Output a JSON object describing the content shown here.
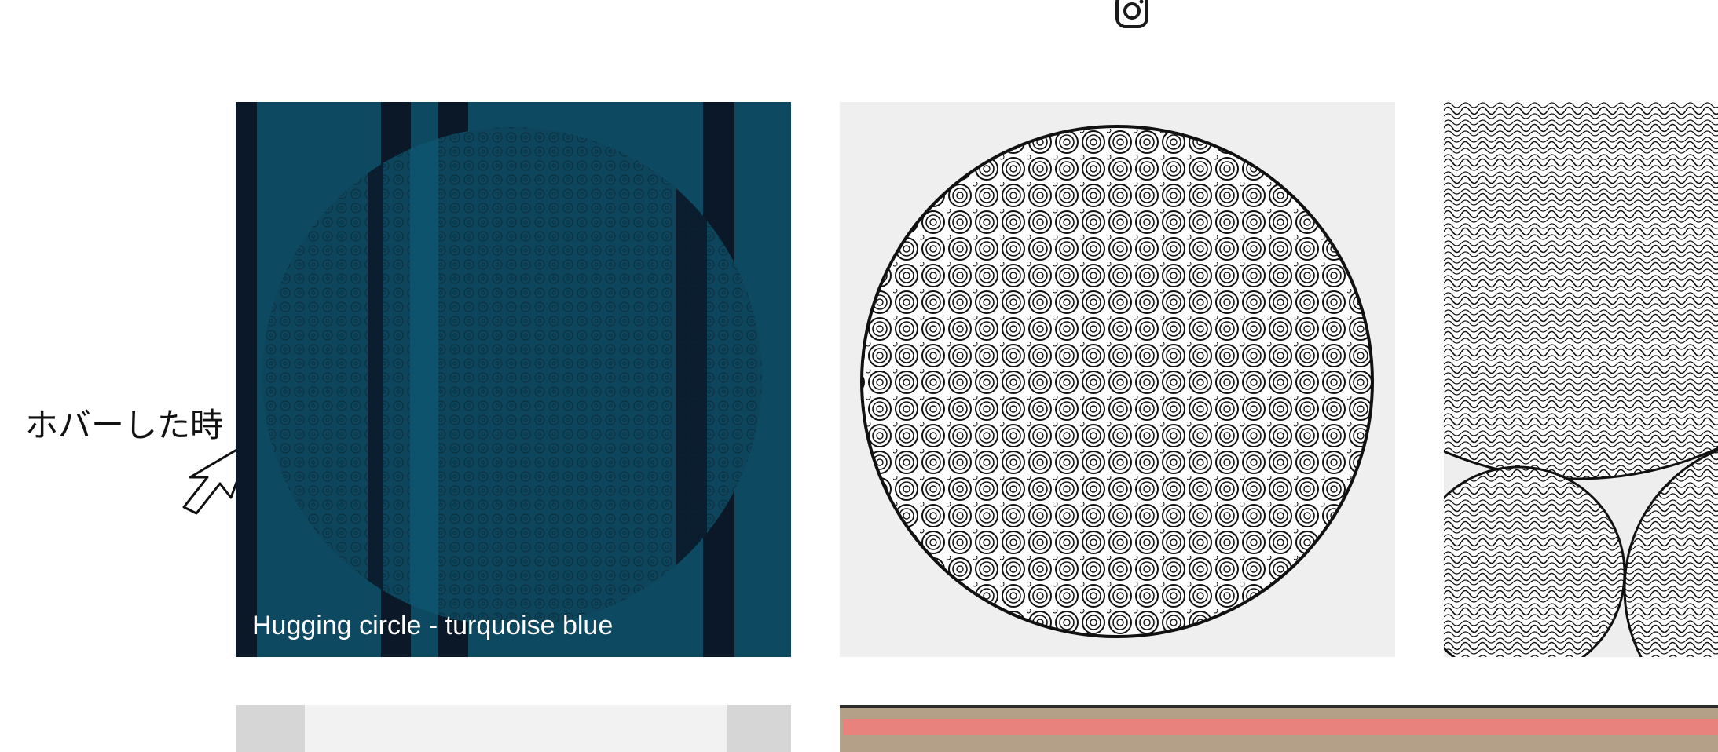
{
  "header": {
    "icon": "instagram-icon"
  },
  "annotation": {
    "label": "ホバーした時",
    "cursor_icon": "arrow-cursor-icon"
  },
  "gallery": {
    "items": [
      {
        "title": "Hugging circle - turquoise blue",
        "colors": {
          "bg": "#0e4a62",
          "stripe": "#0b1522"
        }
      },
      {
        "title": "",
        "colors": {
          "bg": "#efefef",
          "ink": "#111111"
        }
      },
      {
        "title": "",
        "colors": {
          "bg": "#eeeeee",
          "ink": "#111111"
        }
      },
      {
        "title": "",
        "colors": {
          "bg": "#d7d7d7"
        }
      },
      {
        "title": "",
        "colors": {
          "bg": "#b4a089",
          "stripe": "#e8827c"
        }
      }
    ],
    "hover_caption": "Hugging circle - turquoise blue"
  }
}
